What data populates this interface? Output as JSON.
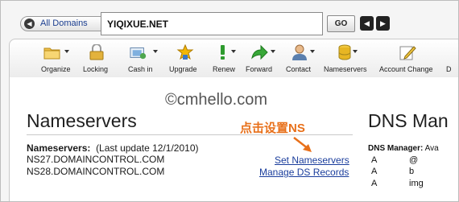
{
  "topbar": {
    "all_domains_label": "All Domains",
    "domain_value": "YIQIXUE.NET",
    "go_label": "GO"
  },
  "toolbar": {
    "items": [
      {
        "label": "Organize",
        "icon": "folder-icon"
      },
      {
        "label": "Locking",
        "icon": "lock-icon"
      },
      {
        "label": "Cash in",
        "icon": "cash-in-icon"
      },
      {
        "label": "Upgrade",
        "icon": "upgrade-icon"
      },
      {
        "label": "Renew",
        "icon": "renew-icon"
      },
      {
        "label": "Forward",
        "icon": "forward-icon"
      },
      {
        "label": "Contact",
        "icon": "contact-icon"
      },
      {
        "label": "Nameservers",
        "icon": "database-icon"
      },
      {
        "label": "Account Change",
        "icon": "edit-icon"
      },
      {
        "label": "D"
      }
    ]
  },
  "watermark": "©cmhello.com",
  "nameservers": {
    "title": "Nameservers",
    "label": "Nameservers:",
    "update_note": "(Last update 12/1/2010)",
    "ns1": "NS27.DOMAINCONTROL.COM",
    "ns2": "NS28.DOMAINCONTROL.COM",
    "set_link": "Set Nameservers",
    "manage_link": "Manage DS Records",
    "annotation": "点击设置NS"
  },
  "dns": {
    "title": "DNS Man",
    "label": "DNS Manager:",
    "label_rest": " Ava",
    "rows": [
      {
        "type": "A",
        "host": "@"
      },
      {
        "type": "A",
        "host": "b"
      },
      {
        "type": "A",
        "host": "img"
      }
    ]
  },
  "colors": {
    "link": "#1a3d9c",
    "annotation": "#e8701a"
  }
}
